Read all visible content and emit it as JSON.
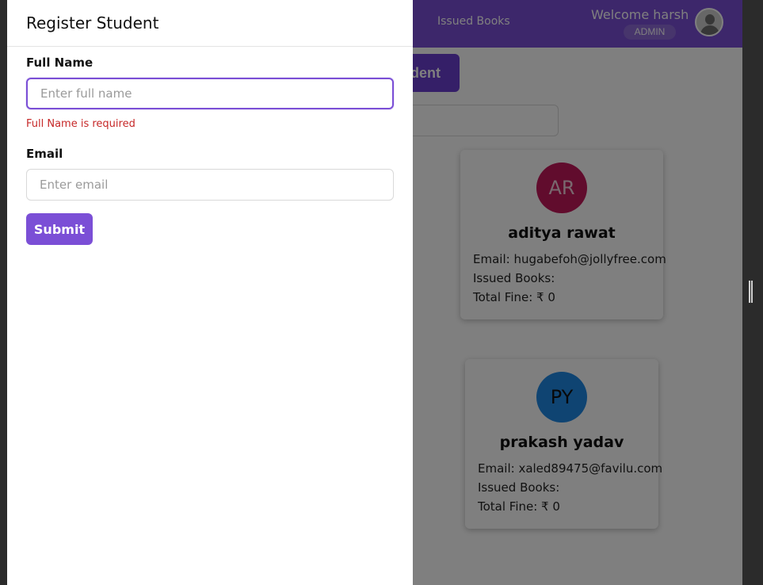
{
  "header": {
    "nav_issued_books": "Issued Books",
    "welcome_text": "Welcome harsh",
    "role_badge": "ADMIN",
    "avatar_icon": "user-avatar-icon"
  },
  "page": {
    "add_button_label": "dent"
  },
  "students": [
    {
      "initials": "AR",
      "name": "aditya rawat",
      "email_line": "Email: hugabefoh@jollyfree.com",
      "issued_line": "Issued Books:",
      "fine_line": "Total Fine: ₹ 0",
      "avatar_color": "#c2185b"
    },
    {
      "initials": "PY",
      "name": "prakash yadav",
      "email_line": "Email: xaled89475@favilu.com",
      "issued_line": "Issued Books:",
      "fine_line": "Total Fine: ₹ 0",
      "avatar_color": "#1e88e5"
    }
  ],
  "drawer": {
    "title": "Register Student",
    "full_name_label": "Full Name",
    "full_name_placeholder": "Enter full name",
    "full_name_value": "",
    "full_name_error": "Full Name is required",
    "email_label": "Email",
    "email_placeholder": "Enter email",
    "email_value": "",
    "submit_label": "Submit"
  },
  "colors": {
    "accent": "#7b4fd6",
    "error": "#c62828"
  }
}
